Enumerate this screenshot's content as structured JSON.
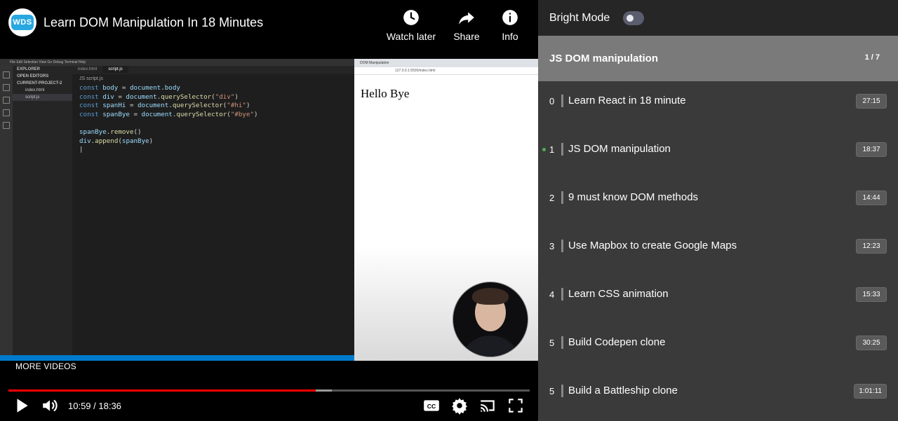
{
  "video": {
    "channel_logo_text": "WDS",
    "title": "Learn DOM Manipulation In 18 Minutes",
    "actions": {
      "watch_later": "Watch later",
      "share": "Share",
      "info": "Info"
    },
    "more_videos": "MORE VIDEOS",
    "time": "10:59 / 18:36",
    "progress_played": 0.59,
    "progress_buffered": 0.62
  },
  "editor": {
    "sidebar": {
      "explorer": "EXPLORER",
      "open_editors": "OPEN EDITORS",
      "project": "CURRENT-PROJECT-2",
      "files": [
        "index.html",
        "script.js"
      ]
    },
    "tabs": [
      "index.html",
      "script.js"
    ],
    "crumb": "JS script.js",
    "code": [
      [
        [
          "kw",
          "const "
        ],
        [
          "var",
          "body"
        ],
        [
          "p",
          " = "
        ],
        [
          "var",
          "document"
        ],
        [
          "p",
          "."
        ],
        [
          "var",
          "body"
        ]
      ],
      [
        [
          "kw",
          "const "
        ],
        [
          "var",
          "div"
        ],
        [
          "p",
          " = "
        ],
        [
          "var",
          "document"
        ],
        [
          "p",
          "."
        ],
        [
          "fn",
          "querySelector"
        ],
        [
          "p",
          "("
        ],
        [
          "str",
          "\"div\""
        ],
        [
          "p",
          ")"
        ]
      ],
      [
        [
          "kw",
          "const "
        ],
        [
          "var",
          "spanHi"
        ],
        [
          "p",
          " = "
        ],
        [
          "var",
          "document"
        ],
        [
          "p",
          "."
        ],
        [
          "fn",
          "querySelector"
        ],
        [
          "p",
          "("
        ],
        [
          "str",
          "\"#hi\""
        ],
        [
          "p",
          ")"
        ]
      ],
      [
        [
          "kw",
          "const "
        ],
        [
          "var",
          "spanBye"
        ],
        [
          "p",
          " = "
        ],
        [
          "var",
          "document"
        ],
        [
          "p",
          "."
        ],
        [
          "fn",
          "querySelector"
        ],
        [
          "p",
          "("
        ],
        [
          "str",
          "\"#bye\""
        ],
        [
          "p",
          ")"
        ]
      ],
      [
        [
          "p",
          ""
        ]
      ],
      [
        [
          "var",
          "spanBye"
        ],
        [
          "p",
          "."
        ],
        [
          "fn",
          "remove"
        ],
        [
          "p",
          "()"
        ]
      ],
      [
        [
          "var",
          "div"
        ],
        [
          "p",
          "."
        ],
        [
          "fn",
          "append"
        ],
        [
          "p",
          "("
        ],
        [
          "var",
          "spanBye"
        ],
        [
          "p",
          ")"
        ]
      ],
      [
        [
          "p",
          "|"
        ]
      ]
    ]
  },
  "browser": {
    "tab": "DOM Manipulation",
    "url": "127.0.0.1:5500/index.html",
    "content": "Hello Bye"
  },
  "playlist": {
    "bright_mode_label": "Bright Mode",
    "bright_mode_on": false,
    "current_title": "JS DOM manipulation",
    "current_count": "1 / 7",
    "items": [
      {
        "index": "0",
        "title": "Learn React in 18 minute",
        "duration": "27:15",
        "playing": false
      },
      {
        "index": "1",
        "title": "JS DOM manipulation",
        "duration": "18:37",
        "playing": true
      },
      {
        "index": "2",
        "title": "9 must know DOM methods",
        "duration": "14:44",
        "playing": false
      },
      {
        "index": "3",
        "title": "Use Mapbox to create Google Maps",
        "duration": "12:23",
        "playing": false
      },
      {
        "index": "4",
        "title": "Learn CSS animation",
        "duration": "15:33",
        "playing": false
      },
      {
        "index": "5",
        "title": "Build Codepen clone",
        "duration": "30:25",
        "playing": false
      },
      {
        "index": "5",
        "title": "Build a Battleship clone",
        "duration": "1:01:11",
        "playing": false
      }
    ]
  },
  "colors": {
    "progress_played": "#ff0000",
    "accent_dot": "#4caf50",
    "logo_blue": "#28a7e0"
  },
  "icons": [
    "clock-icon",
    "share-icon",
    "info-icon",
    "play-icon",
    "volume-icon",
    "captions-icon",
    "settings-icon",
    "cast-icon",
    "fullscreen-icon"
  ]
}
